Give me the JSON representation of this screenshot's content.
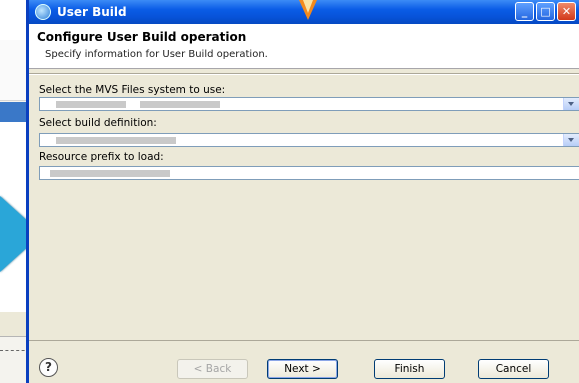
{
  "dialog": {
    "title": "User Build",
    "header": {
      "title": "Configure User Build operation",
      "subtitle": "Specify information for User Build operation."
    },
    "fields": {
      "mvs_label": "Select the MVS Files system to use:",
      "build_def_label": "Select build definition:",
      "prefix_label": "Resource prefix to load:"
    },
    "buttons": {
      "help": "?",
      "back": "< Back",
      "next": "Next >",
      "finish": "Finish",
      "cancel": "Cancel"
    },
    "title_buttons": {
      "minimize": "_",
      "maximize": "□",
      "close": "✕"
    }
  },
  "colors": {
    "titlebar": "#0a5ce6",
    "accent_arrow": "#2aa6d8",
    "marker": "#f28a1e"
  }
}
